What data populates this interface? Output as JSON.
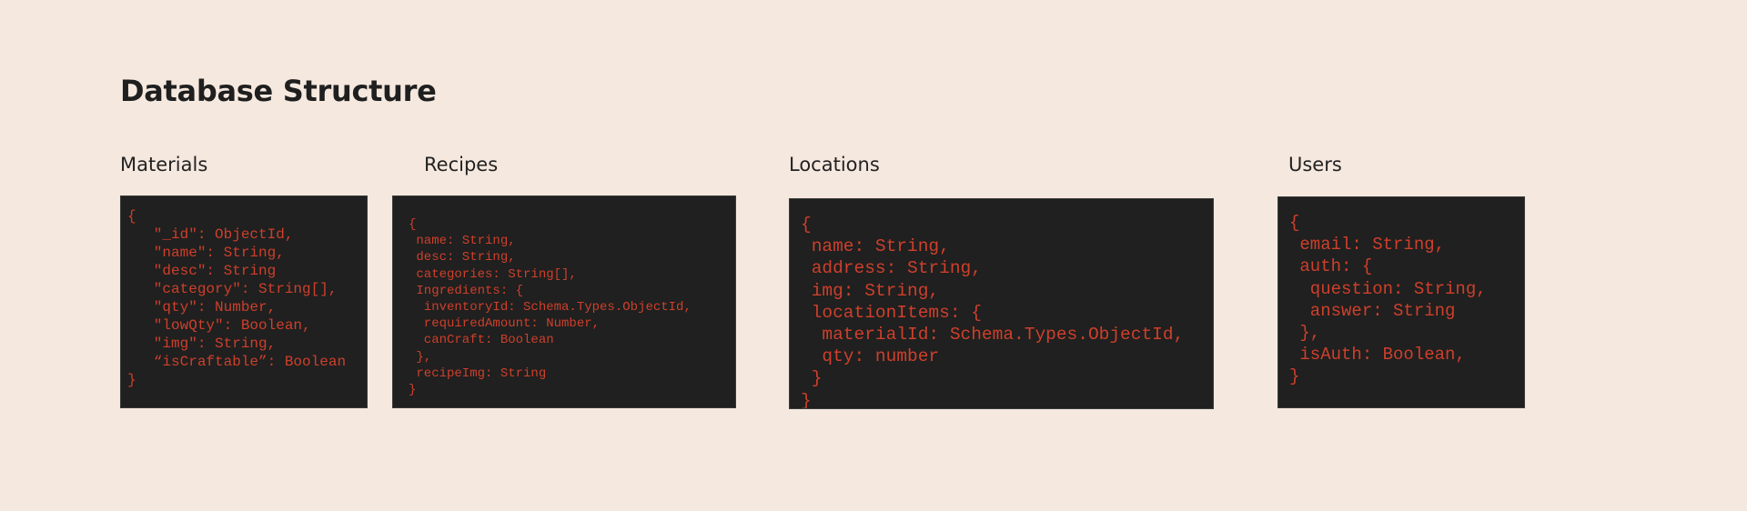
{
  "page": {
    "title": "Database Structure"
  },
  "sections": {
    "materials": {
      "label": "Materials",
      "code": "{\n   \"_id\": ObjectId,\n   \"name\": String,\n   \"desc\": String\n   \"category\": String[],\n   \"qty\": Number,\n   \"lowQty\": Boolean,\n   \"img\": String,\n   “isCraftable”: Boolean\n}"
    },
    "recipes": {
      "label": "Recipes",
      "code": "{\n name: String,\n desc: String,\n categories: String[],\n Ingredients: {\n  inventoryId: Schema.Types.ObjectId,\n  requiredAmount: Number,\n  canCraft: Boolean\n },\n recipeImg: String\n}"
    },
    "locations": {
      "label": "Locations",
      "code": "{\n name: String,\n address: String,\n img: String,\n locationItems: {\n  materialId: Schema.Types.ObjectId,\n  qty: number\n }\n}"
    },
    "users": {
      "label": "Users",
      "code": "{\n email: String,\n auth: {\n  question: String,\n  answer: String\n },\n isAuth: Boolean,\n}"
    }
  },
  "colors": {
    "background": "#f5e8df",
    "code_background": "#1f201f",
    "code_text": "#cf3f2c",
    "heading_text": "#1f1f1f"
  }
}
